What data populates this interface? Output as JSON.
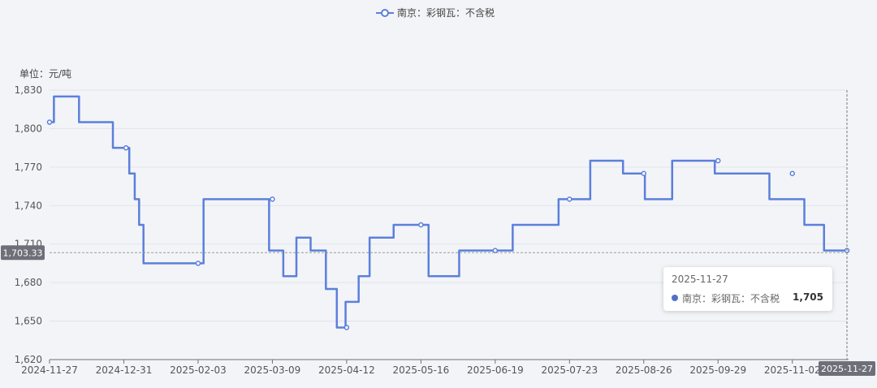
{
  "colors": {
    "series": "#5b7fdc",
    "axis": "#6e7079",
    "grid": "#e0e3ea",
    "pointer_bg": "#6e7079",
    "pointer_text": "#ffffff",
    "background": "#f3f4f7"
  },
  "pointer": {
    "y_label": "1,703.33",
    "x_label": "2025-11-27"
  },
  "tooltip": {
    "date": "2025-11-27",
    "name": "南京：彩钢瓦：不含税",
    "value": "1,705"
  },
  "chart_data": {
    "type": "line",
    "title": "",
    "ylabel": "单位：元/吨",
    "xlabel": "",
    "legend": {
      "entries": [
        "南京：彩钢瓦：不含税"
      ],
      "position": "top-center"
    },
    "ylim": [
      1620,
      1830
    ],
    "yticks": [
      1620,
      1650,
      1680,
      1710,
      1740,
      1770,
      1800,
      1830
    ],
    "ytick_labels": [
      "1,620",
      "1,650",
      "1,680",
      "1,710",
      "1,740",
      "1,770",
      "1,800",
      "1,830"
    ],
    "xticks": [
      "2024-11-27",
      "2024-12-31",
      "2025-02-03",
      "2025-03-09",
      "2025-04-12",
      "2025-05-16",
      "2025-06-19",
      "2025-07-23",
      "2025-08-26",
      "2025-09-29",
      "2025-11-02"
    ],
    "xlim": [
      "2024-11-27",
      "2025-11-27"
    ],
    "grid": true,
    "step": true,
    "series": [
      {
        "name": "南京：彩钢瓦：不含税",
        "points": [
          [
            "2024-11-27",
            1805
          ],
          [
            "2024-12-01",
            1825
          ],
          [
            "2024-12-20",
            1805
          ],
          [
            "2025-01-01",
            1785
          ],
          [
            "2025-01-04",
            1765
          ],
          [
            "2025-01-06",
            1745
          ],
          [
            "2025-01-08",
            1725
          ],
          [
            "2025-01-10",
            1695
          ],
          [
            "2025-03-04",
            1745
          ],
          [
            "2025-03-11",
            1705
          ],
          [
            "2025-03-17",
            1685
          ],
          [
            "2025-03-23",
            1715
          ],
          [
            "2025-03-30",
            1705
          ],
          [
            "2025-04-06",
            1675
          ],
          [
            "2025-04-09",
            1645
          ],
          [
            "2025-04-14",
            1665
          ],
          [
            "2025-04-21",
            1685
          ],
          [
            "2025-04-24",
            1715
          ],
          [
            "2025-05-13",
            1725
          ],
          [
            "2025-05-26",
            1685
          ],
          [
            "2025-06-10",
            1705
          ],
          [
            "2025-07-14",
            1725
          ],
          [
            "2025-07-22",
            1745
          ],
          [
            "2025-08-12",
            1775
          ],
          [
            "2025-08-21",
            1765
          ],
          [
            "2025-09-01",
            1745
          ],
          [
            "2025-09-15",
            1775
          ],
          [
            "2025-10-10",
            1765
          ],
          [
            "2025-11-04",
            1745
          ],
          [
            "2025-11-11",
            1725
          ],
          [
            "2025-11-22",
            1705
          ],
          [
            "2025-11-27",
            1705
          ]
        ],
        "markers": [
          [
            "2024-11-27",
            1805
          ],
          [
            "2025-01-01",
            1785
          ],
          [
            "2025-02-03",
            1695
          ],
          [
            "2025-03-09",
            1745
          ],
          [
            "2025-04-12",
            1645
          ],
          [
            "2025-05-16",
            1725
          ],
          [
            "2025-06-19",
            1705
          ],
          [
            "2025-07-23",
            1745
          ],
          [
            "2025-08-26",
            1765
          ],
          [
            "2025-09-29",
            1775
          ],
          [
            "2025-11-02",
            1765
          ],
          [
            "2025-11-27",
            1705
          ]
        ]
      }
    ]
  }
}
